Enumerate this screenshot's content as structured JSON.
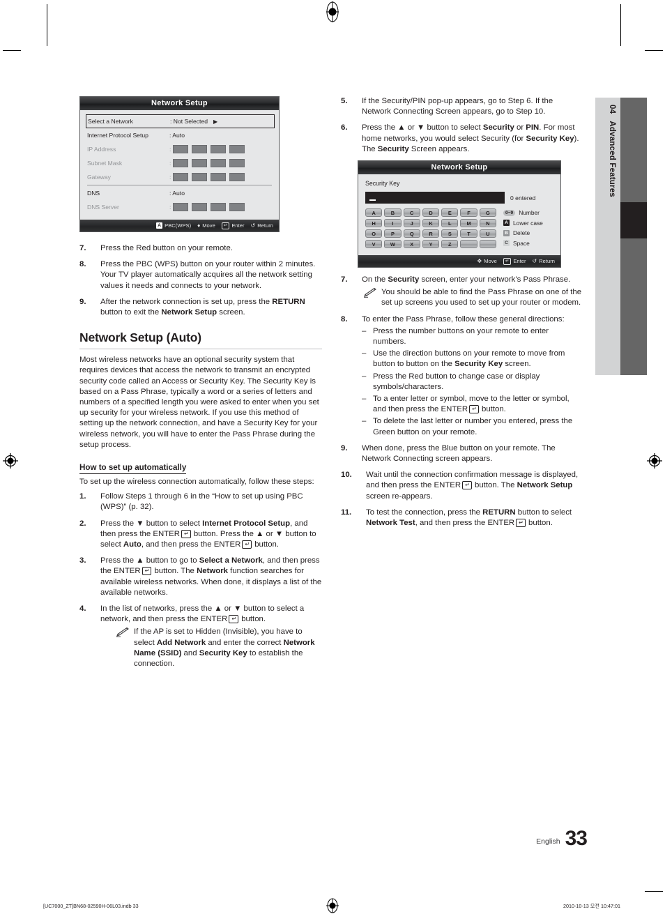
{
  "chapter_tab": {
    "number": "04",
    "label": "Advanced Features"
  },
  "osd_network_setup": {
    "title": "Network Setup",
    "rows": [
      {
        "label": "Select a Network",
        "value": ": Not Selected",
        "type": "selected",
        "arrow": "▶"
      },
      {
        "label": "Internet Protocol Setup",
        "value": ": Auto",
        "type": "normal"
      },
      {
        "label": "IP Address",
        "value": ":",
        "type": "octets"
      },
      {
        "label": "Subnet Mask",
        "value": ":",
        "type": "octets"
      },
      {
        "label": "Gateway",
        "value": ":",
        "type": "octets"
      },
      {
        "label": "DNS",
        "value": ": Auto",
        "type": "normal"
      },
      {
        "label": "DNS Server",
        "value": ":",
        "type": "octets"
      }
    ],
    "footer": [
      {
        "badge": "A",
        "badge_style": "red",
        "label": "PBC(WPS)"
      },
      {
        "badge": "♦",
        "badge_style": "none",
        "label": "Move"
      },
      {
        "badge": "↵",
        "badge_style": "enter",
        "label": "Enter"
      },
      {
        "badge": "↺",
        "badge_style": "none",
        "label": "Return"
      }
    ]
  },
  "osd_security_key": {
    "title": "Network Setup",
    "field_label": "Security Key",
    "input_value": "",
    "entered_count": "0 entered",
    "keys": [
      "A",
      "B",
      "C",
      "D",
      "E",
      "F",
      "G",
      "H",
      "I",
      "J",
      "K",
      "L",
      "M",
      "N",
      "O",
      "P",
      "Q",
      "R",
      "S",
      "T",
      "U",
      "V",
      "W",
      "X",
      "Y",
      "Z",
      "",
      ""
    ],
    "hints": [
      {
        "badge": "0~9",
        "badge_style": "num",
        "label": "Number"
      },
      {
        "badge": "A",
        "badge_style": "a",
        "label": "Lower case"
      },
      {
        "badge": "B",
        "badge_style": "b",
        "label": "Delete"
      },
      {
        "badge": "C",
        "badge_style": "c",
        "label": "Space"
      }
    ],
    "footer": [
      {
        "badge": "✥",
        "badge_style": "none",
        "label": "Move"
      },
      {
        "badge": "↵",
        "badge_style": "enter",
        "label": "Enter"
      },
      {
        "badge": "↺",
        "badge_style": "none",
        "label": "Return"
      }
    ]
  },
  "left_column": {
    "steps_top": [
      {
        "num": "7.",
        "html": "Press the Red button on your remote."
      },
      {
        "num": "8.",
        "html": "Press the PBC (WPS) button on your router within 2 minutes. Your TV player automatically acquires all the network setting values it needs and connects to your network."
      },
      {
        "num": "9.",
        "html": "After the network connection is set up, press the <b>RETURN</b> button to exit the <b>Network Setup</b> screen."
      }
    ],
    "section_title": "Network Setup (Auto)",
    "intro_paragraph": "Most wireless networks have an optional security system that requires devices that access the network to transmit an encrypted security code called an Access or Security Key. The Security Key is based on a Pass Phrase, typically a word or a series of letters and numbers of a specified length you were asked to enter when you set up security for your wireless network.  If you use this method of setting up the network connection, and have a Security Key for your wireless network, you will have to enter the Pass Phrase during the setup process.",
    "sub_title": "How to set up automatically",
    "sub_intro": "To set up the wireless connection automatically, follow these steps:",
    "steps": [
      {
        "num": "1.",
        "html": "Follow Steps 1 through 6 in the “How to set up using PBC (WPS)” (p. 32)."
      },
      {
        "num": "2.",
        "html": "Press the ▼ button to select <b>Internet Protocol Setup</b>, and then press the ENTER<span class=\"enter-glyph\"></span> button. Press the ▲ or ▼ button to select <b>Auto</b>, and then press the ENTER<span class=\"enter-glyph\"></span> button."
      },
      {
        "num": "3.",
        "html": "Press the ▲ button to go to <b>Select a Network</b>, and then press the ENTER<span class=\"enter-glyph\"></span> button. The <b>Network</b> function searches for available wireless networks. When done, it displays a list of the available networks."
      },
      {
        "num": "4.",
        "html": "In the list of networks, press the ▲ or ▼ button to select a network, and then press the ENTER<span class=\"enter-glyph\"></span> button."
      }
    ],
    "step4_note": "If the AP is set to Hidden (Invisible), you have to select <b>Add Network</b> and enter the correct <b>Network Name (SSID)</b> and <b>Security Key</b> to establish the connection."
  },
  "right_column": {
    "steps_top": [
      {
        "num": "5.",
        "html": "If the Security/PIN pop-up appears, go to Step 6. If the Network Connecting Screen appears, go to Step 10."
      },
      {
        "num": "6.",
        "html": "Press the ▲ or ▼ button to select <b>Security</b> or <b>PIN</b>. For most home networks, you would select Security (for <b>Security Key</b>). The <b>Security</b> Screen appears."
      }
    ],
    "step7": {
      "num": "7.",
      "html": "On the <b>Security</b> screen, enter your network’s Pass Phrase."
    },
    "step7_note": "You should be able to find the Pass Phrase on one of the set up screens you used to set up your router or modem.",
    "step8": {
      "num": "8.",
      "html": "To enter the Pass Phrase, follow these general directions:"
    },
    "step8_bullets": [
      "Press the number buttons on your remote to enter numbers.",
      "Use the direction buttons on your remote to move from button to button on the <b>Security Key</b> screen.",
      "Press the Red button to change case or display symbols/characters.",
      "To a enter letter or symbol, move to the letter or symbol, and then press the ENTER<span class=\"enter-glyph\"></span> button.",
      "To delete the last letter or number you entered, press the Green button on your remote."
    ],
    "steps_bottom": [
      {
        "num": "9.",
        "html": "When done, press the Blue button on your remote. The Network Connecting screen appears."
      },
      {
        "num": "10.",
        "html": "Wait until the connection confirmation message is displayed, and then press the ENTER<span class=\"enter-glyph\"></span> button. The <b>Network Setup</b> screen re-appears."
      },
      {
        "num": "11.",
        "html": "To test the connection, press the <b>RETURN</b> button to select <b>Network Test</b>, and then press the ENTER<span class=\"enter-glyph\"></span> button."
      }
    ]
  },
  "page_footer": {
    "language": "English",
    "page_number": "33"
  },
  "print_footer": {
    "left": "[UC7000_ZT]BN68-02590H-06L03.indb   33",
    "right": "2010-10-13   오전 10:47:01"
  }
}
